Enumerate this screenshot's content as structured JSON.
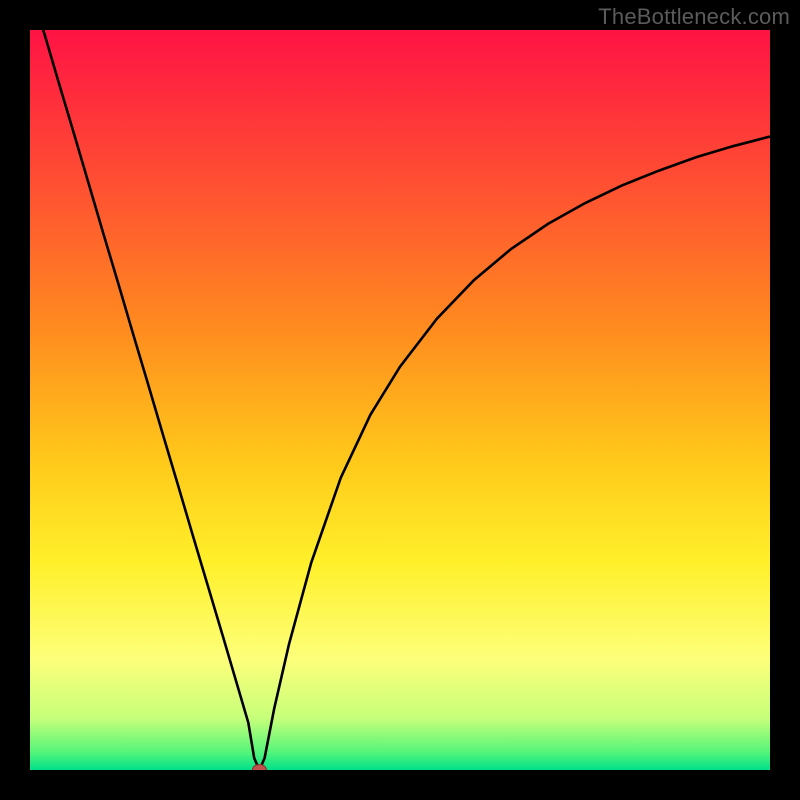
{
  "watermark": "TheBottleneck.com",
  "colors": {
    "frame": "#000000",
    "curve": "#000000",
    "marker_fill": "#c0504d",
    "marker_stroke": "#8b2e2b",
    "gradient_stops": [
      {
        "offset": 0.0,
        "color": "#ff1344"
      },
      {
        "offset": 0.2,
        "color": "#ff4d33"
      },
      {
        "offset": 0.4,
        "color": "#ff8a1f"
      },
      {
        "offset": 0.58,
        "color": "#ffc81a"
      },
      {
        "offset": 0.72,
        "color": "#fff02a"
      },
      {
        "offset": 0.85,
        "color": "#fdff7a"
      },
      {
        "offset": 0.93,
        "color": "#c7ff7a"
      },
      {
        "offset": 0.975,
        "color": "#57f57a"
      },
      {
        "offset": 1.0,
        "color": "#00e08a"
      }
    ]
  },
  "chart_data": {
    "type": "line",
    "title": "",
    "xlabel": "",
    "ylabel": "",
    "xlim": [
      0,
      100
    ],
    "ylim": [
      0,
      100
    ],
    "marker": {
      "x": 31,
      "y": 0
    },
    "series": [
      {
        "name": "curve",
        "x": [
          0,
          2,
          4,
          6,
          8,
          10,
          12,
          14,
          16,
          18,
          20,
          22,
          24,
          26,
          28,
          29.5,
          30.3,
          31,
          31.7,
          33,
          35,
          38,
          42,
          46,
          50,
          55,
          60,
          65,
          70,
          75,
          80,
          85,
          90,
          95,
          100
        ],
        "y": [
          106,
          99.3,
          92.5,
          85.8,
          79,
          72.2,
          65.5,
          58.7,
          52,
          45.2,
          38.5,
          31.7,
          25,
          18.3,
          11.5,
          6.4,
          1.6,
          0,
          1.6,
          8.3,
          17,
          28,
          39.5,
          48,
          54.5,
          61,
          66.2,
          70.4,
          73.8,
          76.6,
          79,
          81,
          82.8,
          84.3,
          85.6
        ]
      }
    ]
  }
}
